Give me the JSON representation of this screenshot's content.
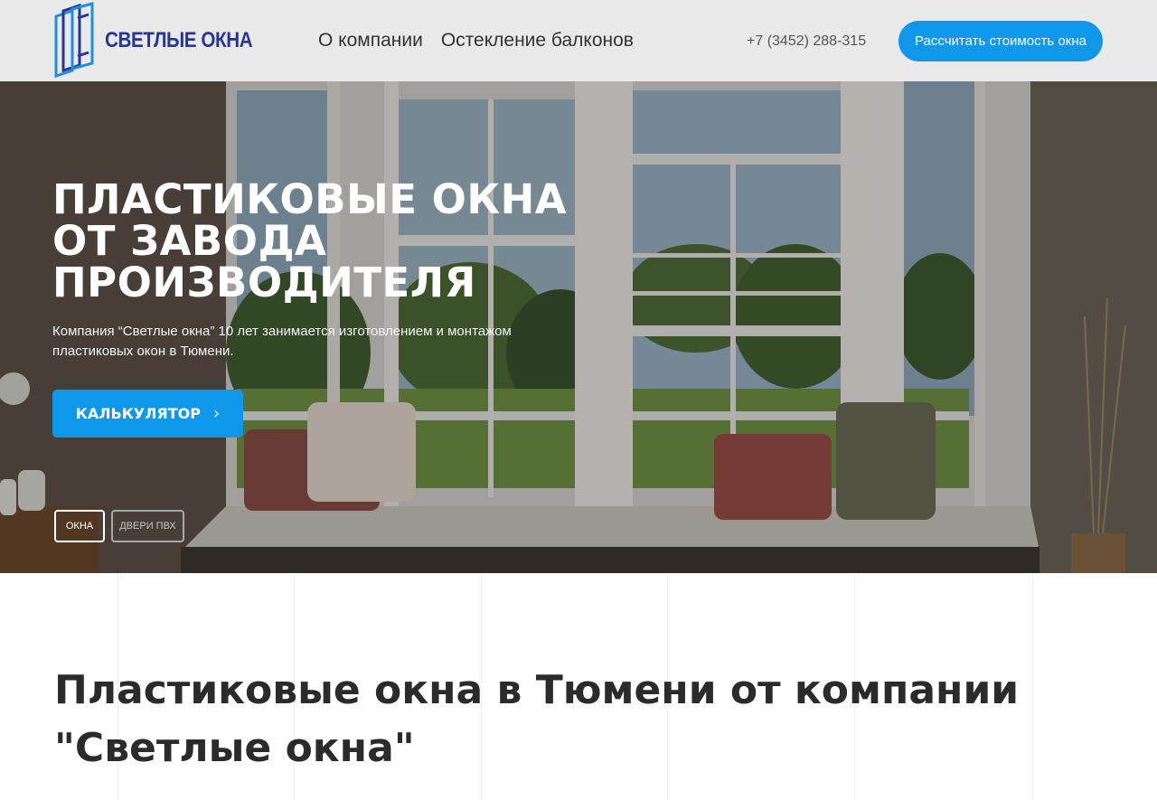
{
  "header": {
    "logo_text": "СВЕТЛЫЕ ОКНА",
    "nav": [
      {
        "label": "О компании"
      },
      {
        "label": "Остекление балконов"
      }
    ],
    "phone": "+7 (3452) 288-315",
    "cta_label": "Рассчитать стоимость окна"
  },
  "hero": {
    "title_lines": [
      "ПЛАСТИКОВЫЕ ОКНА",
      "ОТ ЗАВОДА",
      "ПРОИЗВОДИТЕЛЯ"
    ],
    "subtitle": "Компания “Светлые окна” 10 лет занимается изготовлением и монтажом пластиковых окон в Тюмени.",
    "calc_button_label": "КАЛЬКУЛЯТОР",
    "calc_button_icon": "chevron-right-icon",
    "tabs": [
      {
        "label": "ОКНА",
        "active": true
      },
      {
        "label": "ДВЕРИ ПВХ",
        "active": false
      }
    ]
  },
  "section": {
    "title": "Пластиковые окна в Тюмени от компании \"Светлые окна\""
  },
  "colors": {
    "accent": "#0f97ea",
    "logo_blue": "#2a3593",
    "header_bg": "#e9e9e9"
  }
}
